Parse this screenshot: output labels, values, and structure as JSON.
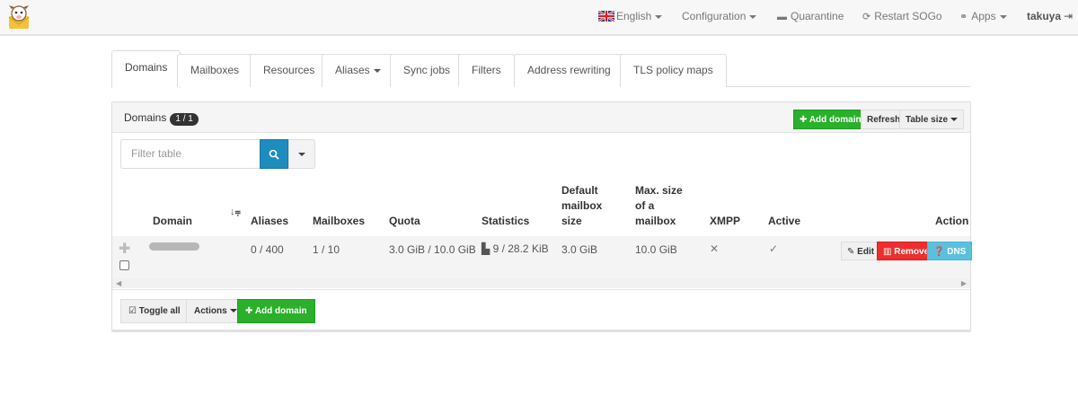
{
  "navbar": {
    "language": "English",
    "configuration": "Configuration",
    "quarantine": "Quarantine",
    "restart": "Restart SOGo",
    "apps": "Apps",
    "user": "takuya"
  },
  "tabs": [
    {
      "label": "Domains"
    },
    {
      "label": "Mailboxes"
    },
    {
      "label": "Resources"
    },
    {
      "label": "Aliases"
    },
    {
      "label": "Sync jobs"
    },
    {
      "label": "Filters"
    },
    {
      "label": "Address rewriting"
    },
    {
      "label": "TLS policy maps"
    }
  ],
  "panel": {
    "title": "Domains",
    "count": "1 / 1",
    "add_domain": "Add domain",
    "refresh": "Refresh",
    "table_size": "Table size"
  },
  "filter": {
    "placeholder": "Filter table"
  },
  "table": {
    "headers": {
      "domain": "Domain",
      "aliases": "Aliases",
      "mailboxes": "Mailboxes",
      "quota": "Quota",
      "statistics": "Statistics",
      "default_mailbox_size": [
        "Default",
        "mailbox",
        "size"
      ],
      "max_size_mailbox": [
        "Max. size",
        "of a",
        "mailbox"
      ],
      "xmpp": "XMPP",
      "active": "Active",
      "action": "Action"
    },
    "rows": [
      {
        "aliases": "0 / 400",
        "mailboxes": "1 / 10",
        "quota": "3.0 GiB / 10.0 GiB",
        "statistics": "9 / 28.2 KiB",
        "default_mailbox_size": "3.0 GiB",
        "max_size": "10.0 GiB",
        "xmpp": "✕",
        "active": "✓",
        "edit": "Edit",
        "remove": "Remove",
        "dns": "DNS"
      }
    ]
  },
  "footer": {
    "toggle_all": "Toggle all",
    "actions": "Actions",
    "add_domain": "Add domain"
  },
  "colors": {
    "success": "#2ab02a",
    "danger": "#ee2e2e",
    "info": "#5bc0de",
    "primary": "#1f8cbf"
  }
}
